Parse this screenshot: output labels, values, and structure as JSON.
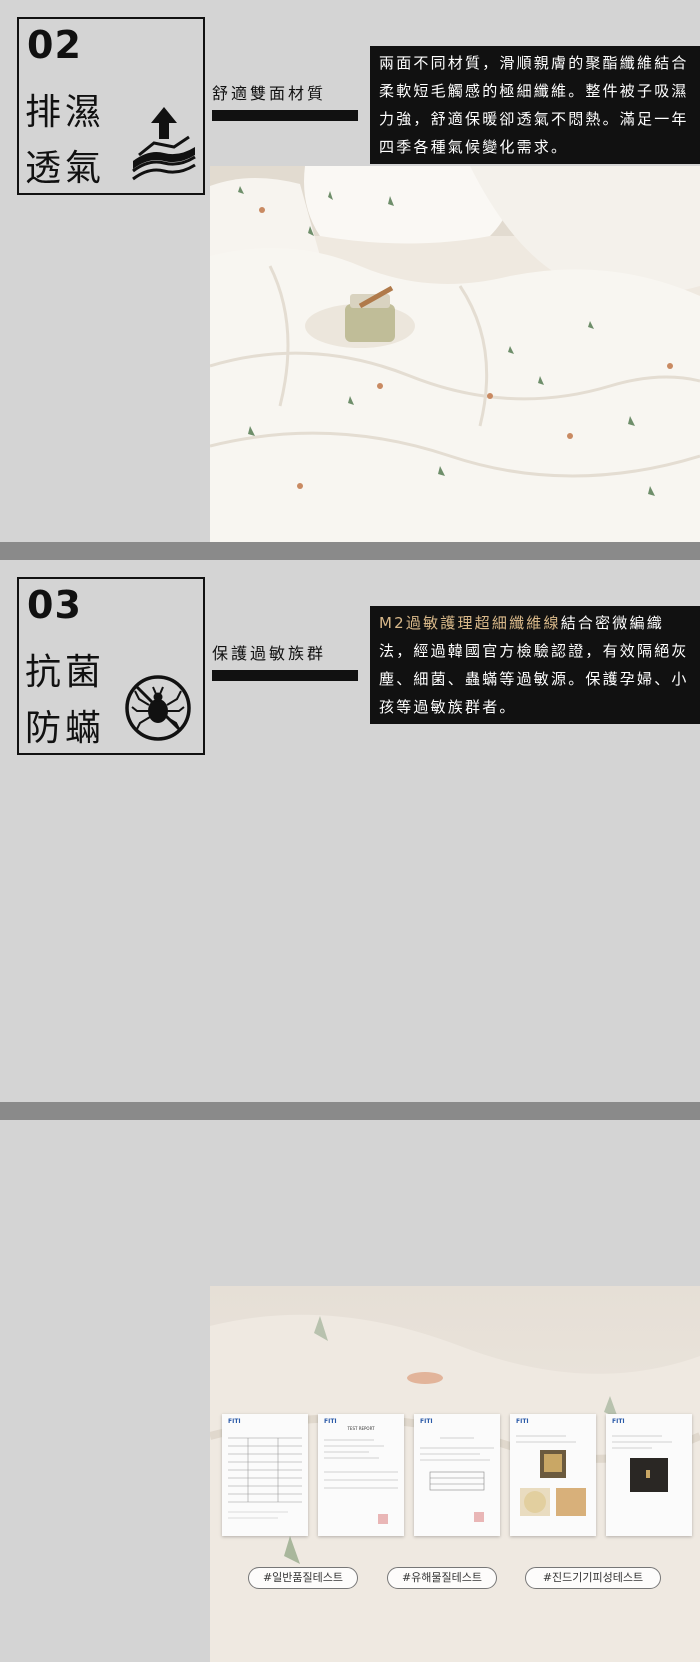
{
  "sections": [
    {
      "number": "02",
      "title_line1": "排濕",
      "title_line2": "透氣",
      "icon": "layers-arrow-up-icon",
      "subtitle": "舒適雙面材質",
      "description": "兩面不同材質，滑順親膚的聚酯纖維結合柔軟短毛觸感的極細纖維。整件被子吸濕力強，舒適保暖卻透氣不悶熱。滿足一年四季各種氣候變化需求。"
    },
    {
      "number": "03",
      "title_line1": "抗菌",
      "title_line2": "防蟎",
      "icon": "no-mite-icon",
      "subtitle": "保護過敏族群",
      "description_highlight": "M2過敏護理超細纖維線",
      "description_rest": "結合密微編織法，經過韓國官方檢驗認證，有效隔絕灰塵、細菌、蟲蟎等過敏源。保護孕婦、小孩等過敏族群者。",
      "documents": [
        {
          "logo": "FITI",
          "title": ""
        },
        {
          "logo": "FITI",
          "title": "TEST REPORT"
        },
        {
          "logo": "FITI",
          "title": ""
        },
        {
          "logo": "FITI",
          "title": ""
        },
        {
          "logo": "FITI",
          "title": ""
        }
      ],
      "tags": [
        "#일반품질테스트",
        "#유해물질테스트",
        "#진드기기피성테스트"
      ]
    }
  ],
  "colors": {
    "background": "#d4d4d4",
    "separator": "#8a8a8a",
    "highlight": "#d9b98a",
    "dark": "#111111"
  }
}
